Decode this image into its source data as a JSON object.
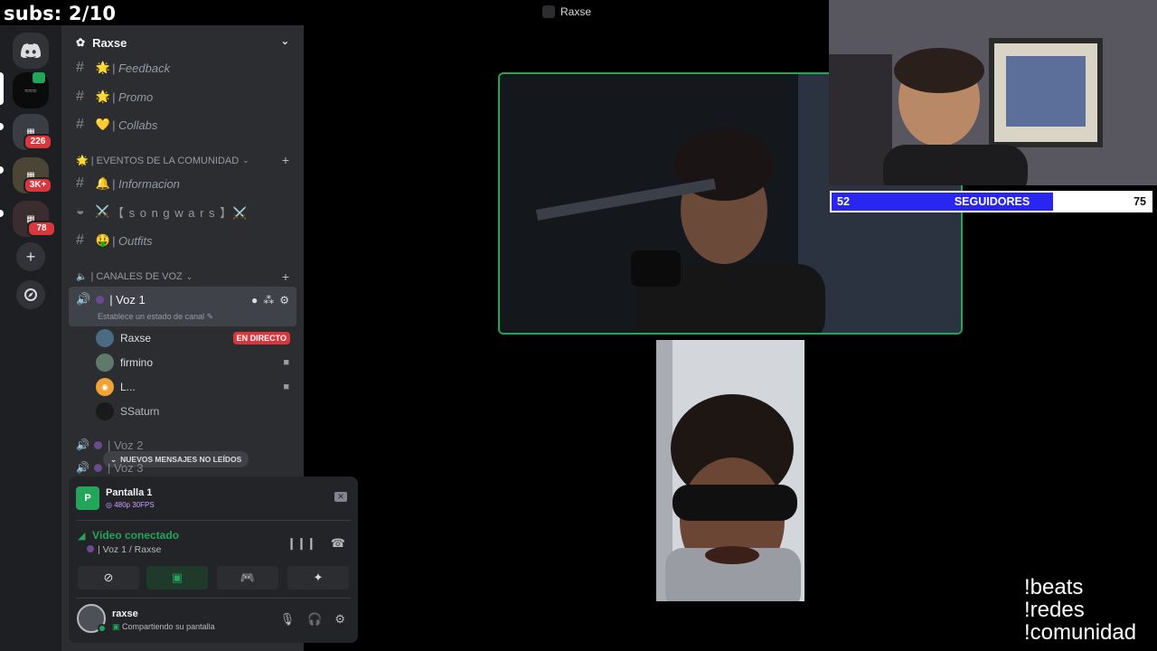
{
  "overlay": {
    "subs": "subs: 2/10",
    "followers": {
      "current": "52",
      "label": "SEGUIDORES",
      "goal": "75",
      "progress": 0.693
    },
    "commands": [
      "!beats",
      "!redes",
      "!comunidad"
    ]
  },
  "window": {
    "title": "Raxse"
  },
  "rail": {
    "badges": [
      "226",
      "3K+",
      "78"
    ]
  },
  "server": {
    "name": "Raxse",
    "channels_top": [
      {
        "emoji": "🌟",
        "name": "| Feedback"
      },
      {
        "emoji": "🌟",
        "name": "| Promo"
      },
      {
        "emoji": "💛",
        "name": "| Collabs"
      }
    ],
    "category_events": "🌟 | EVENTOS DE LA COMUNIDAD",
    "channels_events": [
      {
        "emoji": "🔔",
        "name": "| Informacion"
      },
      {
        "emoji": "⚔️",
        "name": "【 s o n g w a r s 】⚔️"
      },
      {
        "emoji": "🤑",
        "name": "| Outfits"
      }
    ],
    "category_voice": "| CANALES DE VOZ",
    "voice_active": {
      "name": "| Voz 1",
      "status": "Establece un estado de canal"
    },
    "members": [
      {
        "name": "Raxse",
        "badge": "EN DIRECTO"
      },
      {
        "name": "firmino"
      },
      {
        "name": "L..."
      },
      {
        "name": "SSaturn"
      }
    ],
    "voice_2": "| Voz 2",
    "voice_3": "| Voz 3",
    "new_messages": "NUEVOS MENSAJES NO LEÍDOS"
  },
  "panel": {
    "screen_title": "Pantalla 1",
    "screen_quality": "480p 30FPS",
    "voice_connected": "Vídeo conectado",
    "voice_where": "| Voz 1 / Raxse",
    "user_name": "raxse",
    "user_status": "Compartiendo su pantalla"
  },
  "colors": {
    "discord_green": "#23a55a",
    "discord_red": "#da373c",
    "follow_fill": "#2a26f2"
  }
}
